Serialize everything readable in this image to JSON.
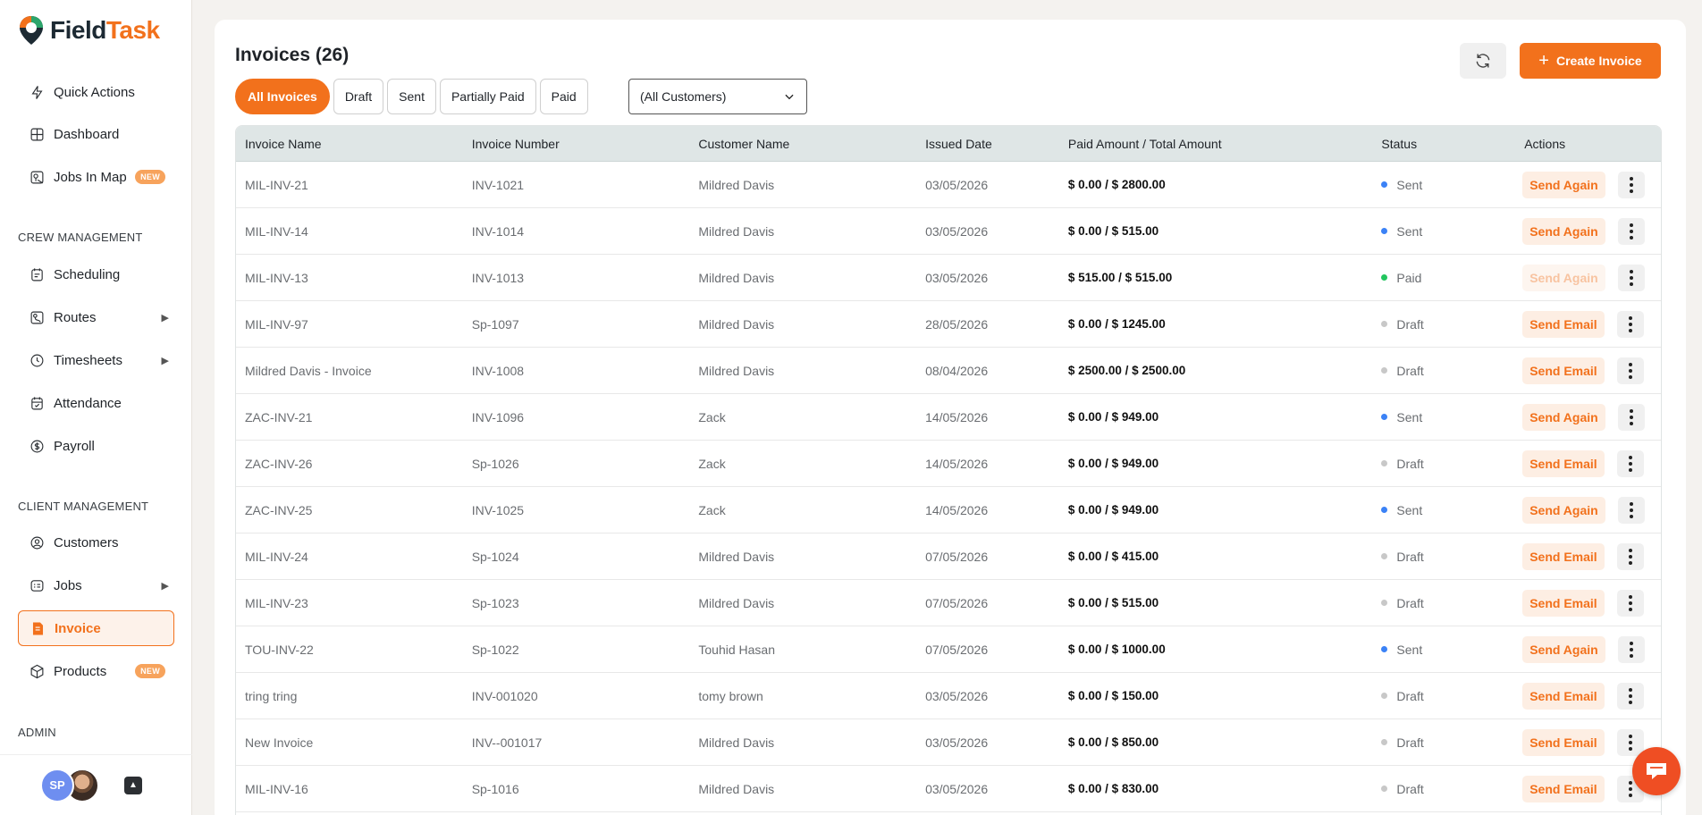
{
  "app": {
    "name_part1": "Field",
    "name_part2": "Task",
    "brand_color": "#f2711c"
  },
  "sidebar": {
    "top_items": [
      {
        "label": "Quick Actions",
        "icon": "bolt-icon"
      },
      {
        "label": "Dashboard",
        "icon": "grid-icon"
      },
      {
        "label": "Jobs In Map",
        "icon": "map-icon",
        "badge": "NEW"
      }
    ],
    "crew_section": "CREW MANAGEMENT",
    "crew_items": [
      {
        "label": "Scheduling",
        "icon": "calendar-icon"
      },
      {
        "label": "Routes",
        "icon": "route-icon",
        "has_submenu": true
      },
      {
        "label": "Timesheets",
        "icon": "clock-icon",
        "has_submenu": true
      },
      {
        "label": "Attendance",
        "icon": "calendar-check-icon"
      },
      {
        "label": "Payroll",
        "icon": "dollar-icon"
      }
    ],
    "client_section": "CLIENT MANAGEMENT",
    "client_items": [
      {
        "label": "Customers",
        "icon": "user-circle-icon"
      },
      {
        "label": "Jobs",
        "icon": "jobs-icon",
        "has_submenu": true
      },
      {
        "label": "Invoice",
        "icon": "invoice-icon",
        "active": true
      },
      {
        "label": "Products",
        "icon": "box-icon",
        "badge": "NEW"
      }
    ],
    "admin_section": "ADMIN",
    "user_initials": "SP"
  },
  "header": {
    "title": "Invoices (26)",
    "create_label": "Create Invoice"
  },
  "filters": {
    "tabs": [
      "All Invoices",
      "Draft",
      "Sent",
      "Partially Paid",
      "Paid"
    ],
    "active_tab": "All Invoices",
    "customer_select": "(All Customers)"
  },
  "table": {
    "columns": [
      "Invoice Name",
      "Invoice Number",
      "Customer Name",
      "Issued Date",
      "Paid Amount / Total Amount",
      "Status",
      "Actions"
    ],
    "rows": [
      {
        "name": "MIL-INV-21",
        "number": "INV-1021",
        "customer": "Mildred Davis",
        "date": "03/05/2026",
        "amount": "$ 0.00 / $ 2800.00",
        "status": "Sent",
        "action": "Send Again"
      },
      {
        "name": "MIL-INV-14",
        "number": "INV-1014",
        "customer": "Mildred Davis",
        "date": "03/05/2026",
        "amount": "$ 0.00 / $ 515.00",
        "status": "Sent",
        "action": "Send Again"
      },
      {
        "name": "MIL-INV-13",
        "number": "INV-1013",
        "customer": "Mildred Davis",
        "date": "03/05/2026",
        "amount": "$ 515.00 / $ 515.00",
        "status": "Paid",
        "action": "Send Again",
        "action_disabled": true
      },
      {
        "name": "MIL-INV-97",
        "number": "Sp-1097",
        "customer": "Mildred Davis",
        "date": "28/05/2026",
        "amount": "$ 0.00 / $ 1245.00",
        "status": "Draft",
        "action": "Send Email"
      },
      {
        "name": "Mildred Davis - Invoice",
        "number": "INV-1008",
        "customer": "Mildred Davis",
        "date": "08/04/2026",
        "amount": "$ 2500.00 / $ 2500.00",
        "status": "Draft",
        "action": "Send Email"
      },
      {
        "name": "ZAC-INV-21",
        "number": "INV-1096",
        "customer": "Zack",
        "date": "14/05/2026",
        "amount": "$ 0.00 / $ 949.00",
        "status": "Sent",
        "action": "Send Again"
      },
      {
        "name": "ZAC-INV-26",
        "number": "Sp-1026",
        "customer": "Zack",
        "date": "14/05/2026",
        "amount": "$ 0.00 / $ 949.00",
        "status": "Draft",
        "action": "Send Email"
      },
      {
        "name": "ZAC-INV-25",
        "number": "INV-1025",
        "customer": "Zack",
        "date": "14/05/2026",
        "amount": "$ 0.00 / $ 949.00",
        "status": "Sent",
        "action": "Send Again"
      },
      {
        "name": "MIL-INV-24",
        "number": "Sp-1024",
        "customer": "Mildred Davis",
        "date": "07/05/2026",
        "amount": "$ 0.00 / $ 415.00",
        "status": "Draft",
        "action": "Send Email"
      },
      {
        "name": "MIL-INV-23",
        "number": "Sp-1023",
        "customer": "Mildred Davis",
        "date": "07/05/2026",
        "amount": "$ 0.00 / $ 515.00",
        "status": "Draft",
        "action": "Send Email"
      },
      {
        "name": "TOU-INV-22",
        "number": "Sp-1022",
        "customer": "Touhid Hasan",
        "date": "07/05/2026",
        "amount": "$ 0.00 / $ 1000.00",
        "status": "Sent",
        "action": "Send Again"
      },
      {
        "name": "tring tring",
        "number": "INV-001020",
        "customer": "tomy brown",
        "date": "03/05/2026",
        "amount": "$ 0.00 / $ 150.00",
        "status": "Draft",
        "action": "Send Email"
      },
      {
        "name": "New Invoice",
        "number": "INV--001017",
        "customer": "Mildred Davis",
        "date": "03/05/2026",
        "amount": "$ 0.00 / $ 850.00",
        "status": "Draft",
        "action": "Send Email"
      },
      {
        "name": "MIL-INV-16",
        "number": "Sp-1016",
        "customer": "Mildred Davis",
        "date": "03/05/2026",
        "amount": "$ 0.00 / $ 830.00",
        "status": "Draft",
        "action": "Send Email"
      }
    ]
  },
  "status_colors": {
    "Sent": "#3b82f6",
    "Paid": "#22c55e",
    "Draft": "#c8c8c8"
  }
}
